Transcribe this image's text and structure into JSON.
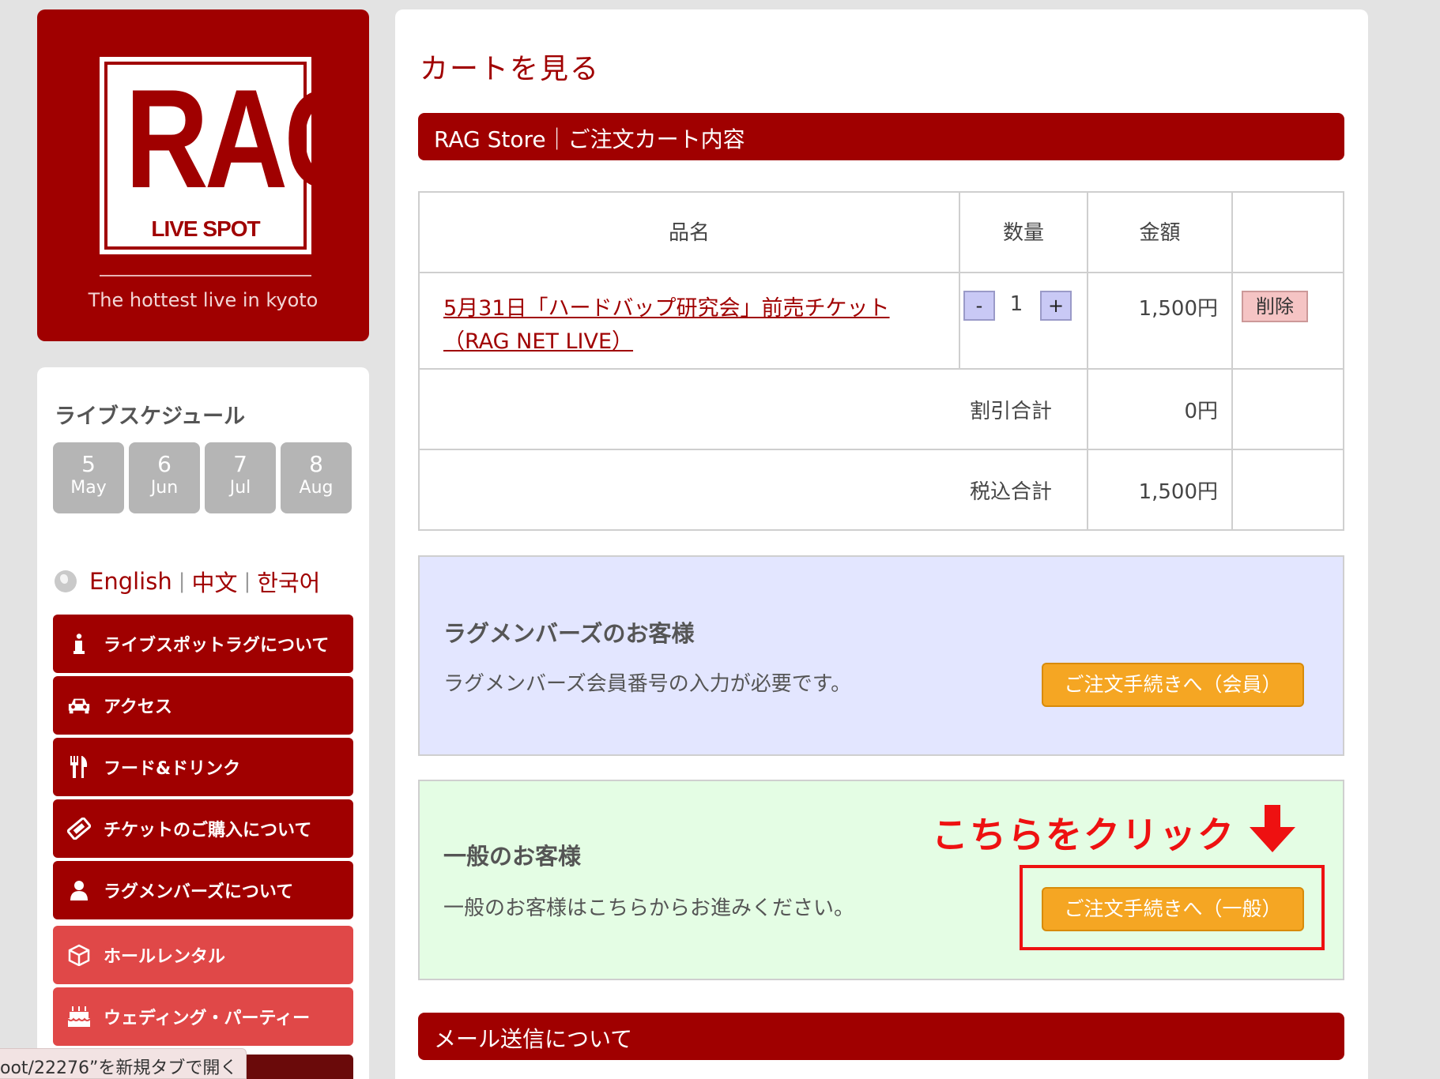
{
  "logo": {
    "text": "RAG",
    "subtitle": "LIVE SPOT",
    "tagline": "The hottest live in kyoto"
  },
  "sidebar": {
    "schedule_title": "ライブスケジュール",
    "months": [
      {
        "num": "5",
        "name": "May"
      },
      {
        "num": "6",
        "name": "Jun"
      },
      {
        "num": "7",
        "name": "Jul"
      },
      {
        "num": "8",
        "name": "Aug"
      }
    ],
    "languages": [
      "English",
      "中文",
      "한국어"
    ],
    "lang_sep": "|",
    "nav": [
      {
        "label": "ライブスポットラグについて",
        "icon": "info-icon"
      },
      {
        "label": "アクセス",
        "icon": "car-icon"
      },
      {
        "label": "フード&ドリンク",
        "icon": "fork-knife-icon"
      },
      {
        "label": "チケットのご購入について",
        "icon": "ticket-icon"
      },
      {
        "label": "ラグメンバーズについて",
        "icon": "user-icon"
      },
      {
        "label": "ホールレンタル",
        "icon": "box-icon"
      },
      {
        "label": "ウェディング・パーティー",
        "icon": "cake-icon"
      }
    ],
    "status_tooltip": "oot/22276”を新規タブで開く"
  },
  "main": {
    "page_title": "カートを見る",
    "cart_header": "RAG Store｜ご注文カート内容",
    "table": {
      "headers": [
        "品名",
        "数量",
        "金額",
        ""
      ],
      "item": {
        "name": "5月31日「ハードバップ研究会」前売チケット（RAG NET LIVE）",
        "qty_minus": "-",
        "qty": "1",
        "qty_plus": "+",
        "price": "1,500円",
        "delete_label": "削除"
      },
      "discount_label": "割引合計",
      "discount_value": "0円",
      "total_label": "税込合計",
      "total_value": "1,500円"
    },
    "member_panel": {
      "title": "ラグメンバーズのお客様",
      "desc": "ラグメンバーズ会員番号の入力が必要です。",
      "button": "ご注文手続きへ（会員）"
    },
    "general_panel": {
      "title": "一般のお客様",
      "desc": "一般のお客様はこちらからお進みください。",
      "button": "ご注文手続きへ（一般）",
      "annotation": "こちらをクリック"
    },
    "mail_header": "メール送信について"
  },
  "colors": {
    "brand": "#a00000",
    "accent": "#f5a623",
    "annotation": "#ee1111"
  }
}
